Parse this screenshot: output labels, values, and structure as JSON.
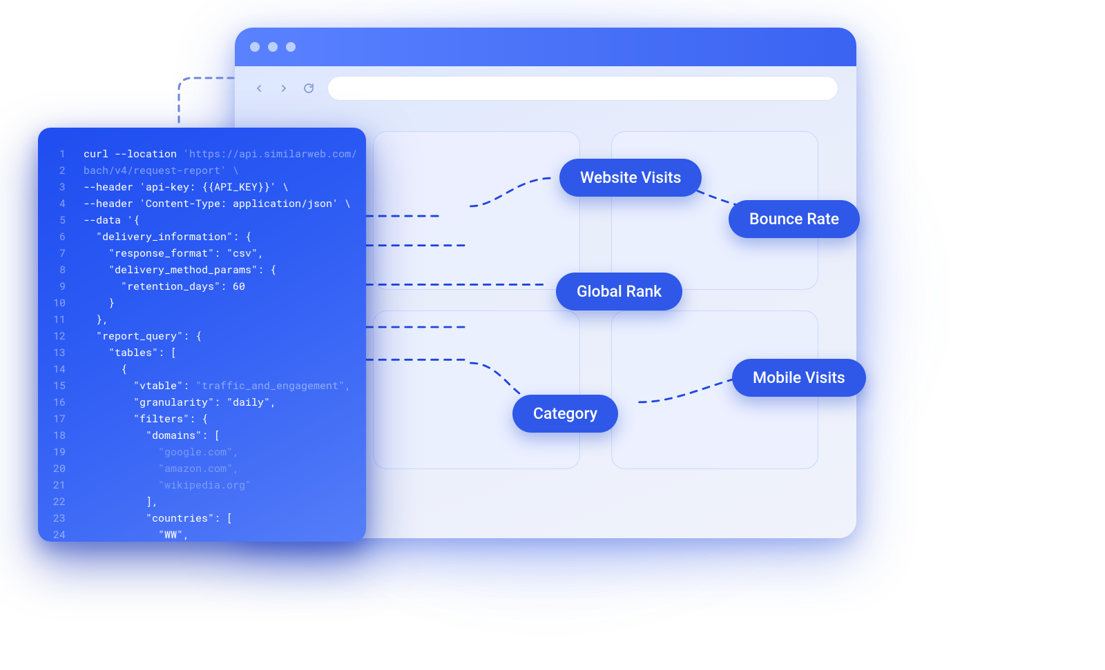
{
  "browser": {
    "window_controls": [
      "close",
      "minimize",
      "zoom"
    ],
    "nav": {
      "back_icon": "arrow-left",
      "forward_icon": "arrow-right",
      "reload_icon": "reload"
    },
    "url": ""
  },
  "metrics": {
    "website_visits": "Website Visits",
    "bounce_rate": "Bounce Rate",
    "global_rank": "Global Rank",
    "category": "Category",
    "mobile_visits": "Mobile Visits"
  },
  "code": {
    "line_numbers": [
      1,
      2,
      3,
      4,
      5,
      6,
      7,
      8,
      9,
      10,
      11,
      12,
      13,
      14,
      15,
      16,
      17,
      18,
      19,
      20,
      21,
      22,
      23,
      24
    ],
    "lines": [
      {
        "text": "curl --location 'https://api.similarweb.com/",
        "cls": "kw",
        "dim_from": 15
      },
      {
        "text": "bach/v4/request-report' \\",
        "cls": "dim"
      },
      {
        "text": "--header 'api-key: {{API_KEY}}' \\",
        "cls": "kw"
      },
      {
        "text": "--header 'Content-Type: application/json' \\",
        "cls": "kw"
      },
      {
        "text": "--data '{",
        "cls": "kw"
      },
      {
        "text": "  \"delivery_information\": {",
        "cls": "kw"
      },
      {
        "text": "    \"response_format\": \"csv\",",
        "cls": "kw"
      },
      {
        "text": "    \"delivery_method_params\": {",
        "cls": "kw"
      },
      {
        "text": "      \"retention_days\": 60",
        "cls": "kw"
      },
      {
        "text": "    }",
        "cls": "kw"
      },
      {
        "text": "  },",
        "cls": "kw"
      },
      {
        "text": "  \"report_query\": {",
        "cls": "kw"
      },
      {
        "text": "    \"tables\": [",
        "cls": "kw"
      },
      {
        "text": "      {",
        "cls": "kw"
      },
      {
        "text": "        \"vtable\": \"traffic_and_engagement\",",
        "cls": "kw",
        "dim_from": 18
      },
      {
        "text": "        \"granularity\": \"daily\",",
        "cls": "kw"
      },
      {
        "text": "        \"filters\": {",
        "cls": "kw"
      },
      {
        "text": "          \"domains\": [",
        "cls": "kw"
      },
      {
        "text": "            \"google.com\",",
        "cls": "faint"
      },
      {
        "text": "            \"amazon.com\",",
        "cls": "faint"
      },
      {
        "text": "            \"wikipedia.org\"",
        "cls": "faint"
      },
      {
        "text": "          ],",
        "cls": "kw"
      },
      {
        "text": "          \"countries\": [",
        "cls": "kw"
      },
      {
        "text": "            \"WW\",",
        "cls": "kw"
      }
    ]
  },
  "colors": {
    "accent": "#2f58e8",
    "accent_light": "#4a72f5",
    "code_bg_start": "#1f4df0",
    "code_bg_end": "#567ef8",
    "panel_bg": "#ebf0ff",
    "dashed": "#1e46e0"
  }
}
